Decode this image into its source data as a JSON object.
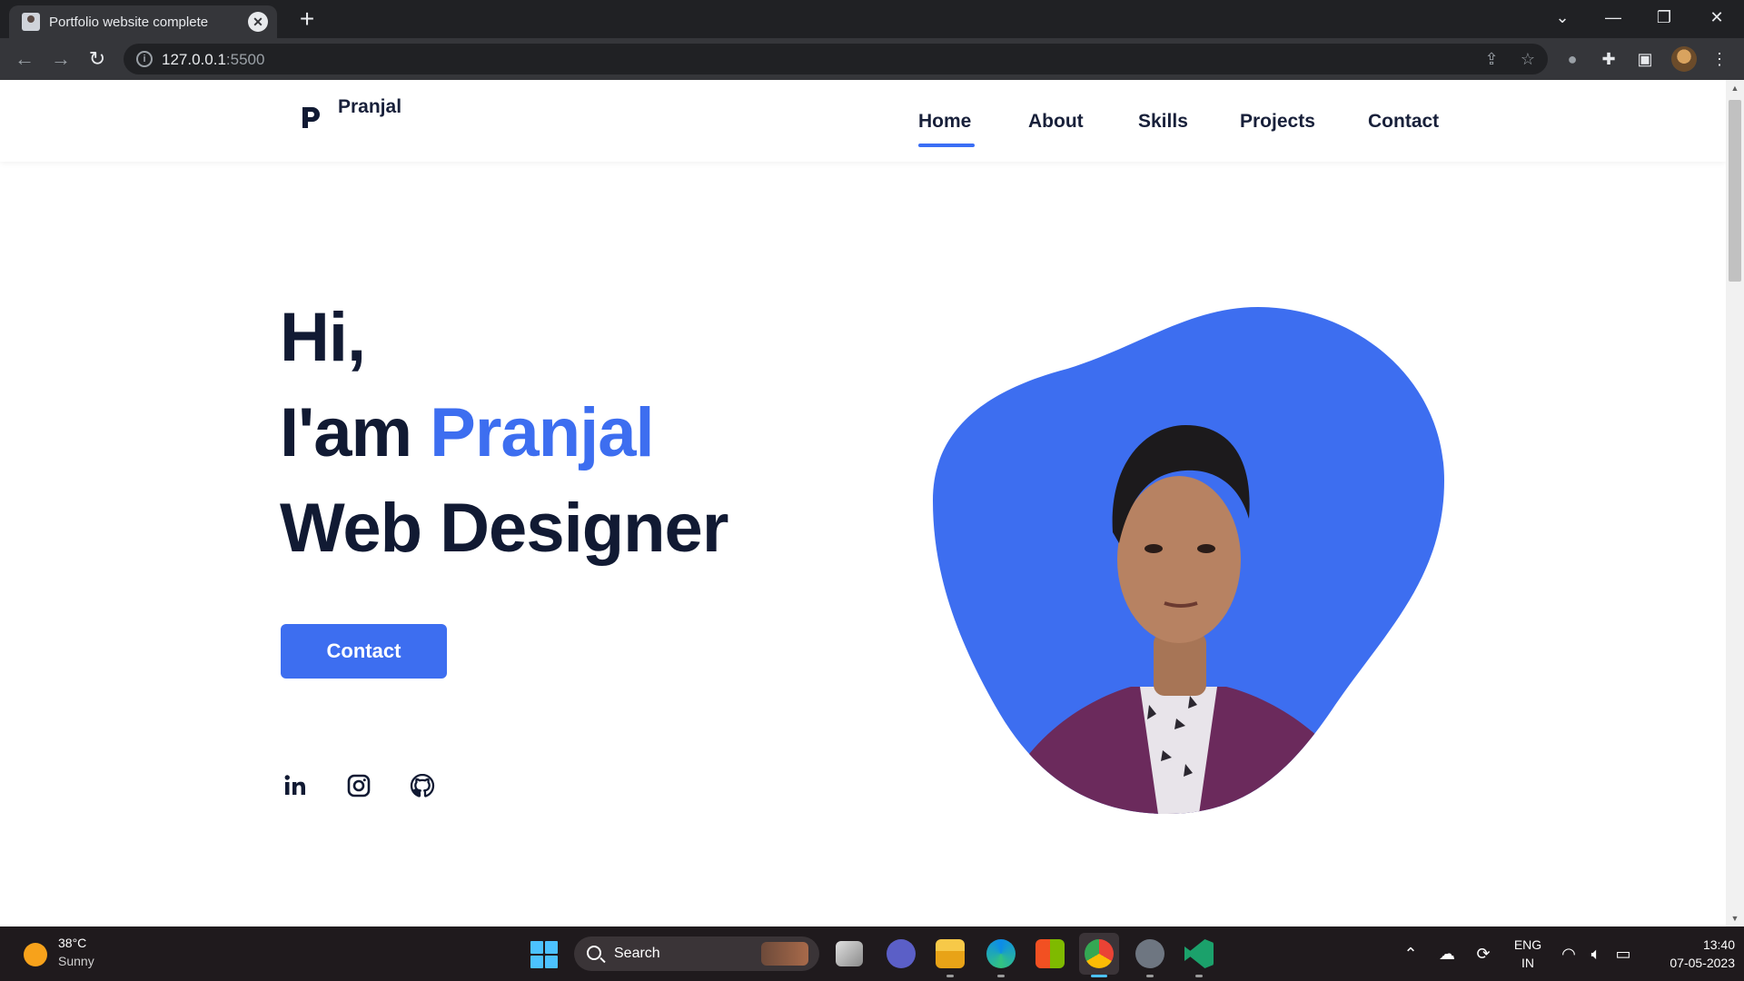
{
  "browser": {
    "tab_title": "Portfolio website complete",
    "tab_close": "✕",
    "new_tab": "+",
    "url_host": "127.0.0.1",
    "url_port": ":5500",
    "window_controls": {
      "collapse": "⌄",
      "minimize": "—",
      "restore": "❐",
      "close": "✕"
    },
    "nav": {
      "back": "←",
      "forward": "→",
      "reload": "↻"
    }
  },
  "site": {
    "logo_letter": "P",
    "logo_text": "Pranjal",
    "nav": [
      "Home",
      "About",
      "Skills",
      "Projects",
      "Contact"
    ],
    "active_nav": "Home",
    "hero": {
      "line1": "Hi,",
      "line2_prefix": "I'am ",
      "line2_name": "Pranjal",
      "line3": "Web Designer"
    },
    "cta_label": "Contact",
    "social": [
      "linkedin-icon",
      "instagram-icon",
      "github-icon"
    ],
    "accent_color": "#3d6ef0",
    "text_color": "#111a33"
  },
  "taskbar": {
    "weather_temp": "38°C",
    "weather_condition": "Sunny",
    "search_label": "Search",
    "language": "ENG",
    "region": "IN",
    "time": "13:40",
    "date": "07-05-2023"
  }
}
